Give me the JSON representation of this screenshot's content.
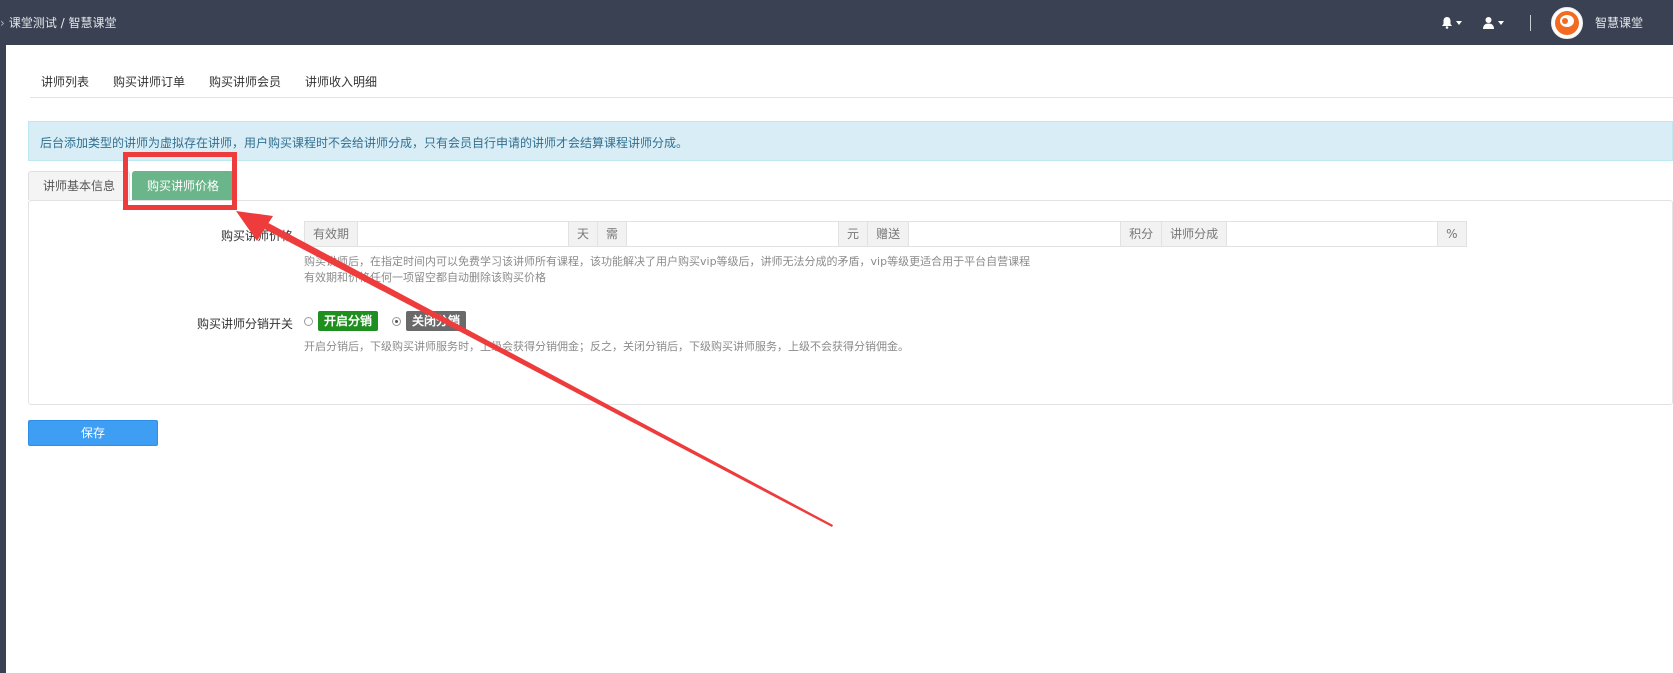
{
  "header": {
    "breadcrumb": "课堂测试 / 智慧课堂",
    "brand_name": "智慧课堂",
    "icons": [
      "bell-icon",
      "user-icon"
    ]
  },
  "nav_tabs": [
    {
      "label": "讲师列表"
    },
    {
      "label": "购买讲师订单"
    },
    {
      "label": "购买讲师会员"
    },
    {
      "label": "讲师收入明细"
    }
  ],
  "alert": {
    "text": "后台添加类型的讲师为虚拟存在讲师，用户购买课程时不会给讲师分成，只有会员自行申请的讲师才会结算课程讲师分成。"
  },
  "sub_tabs": [
    {
      "label": "讲师基本信息",
      "active": false
    },
    {
      "label": "购买讲师价格",
      "active": true
    }
  ],
  "form": {
    "price_label": "购买讲师价格",
    "addons": {
      "validity": "有效期",
      "day": "天",
      "need": "需",
      "yuan": "元",
      "gift": "赠送",
      "points": "积分",
      "share": "讲师分成",
      "percent": "%"
    },
    "values": {
      "validity": "",
      "need": "",
      "gift": "",
      "share": ""
    },
    "help_line1": "购买讲师后，在指定时间内可以免费学习该讲师所有课程，该功能解决了用户购买vip等级后，讲师无法分成的矛盾，vip等级更适合用于平台自营课程",
    "help_line2": "有效期和价格任何一项留空都自动删除该购买价格",
    "dist_label": "购买讲师分销开关",
    "dist_on": "开启分销",
    "dist_off": "关闭分销",
    "dist_selected": "关闭分销",
    "dist_help": "开启分销后，下级购买讲师服务时，上级会获得分销佣金；反之，关闭分销后，下级购买讲师服务，上级不会获得分销佣金。"
  },
  "save_label": "保存",
  "colors": {
    "topbar": "#3a4152",
    "active_tab": "#6ab58a",
    "primary": "#3e9ef3",
    "annotation": "#ee3b3b"
  }
}
